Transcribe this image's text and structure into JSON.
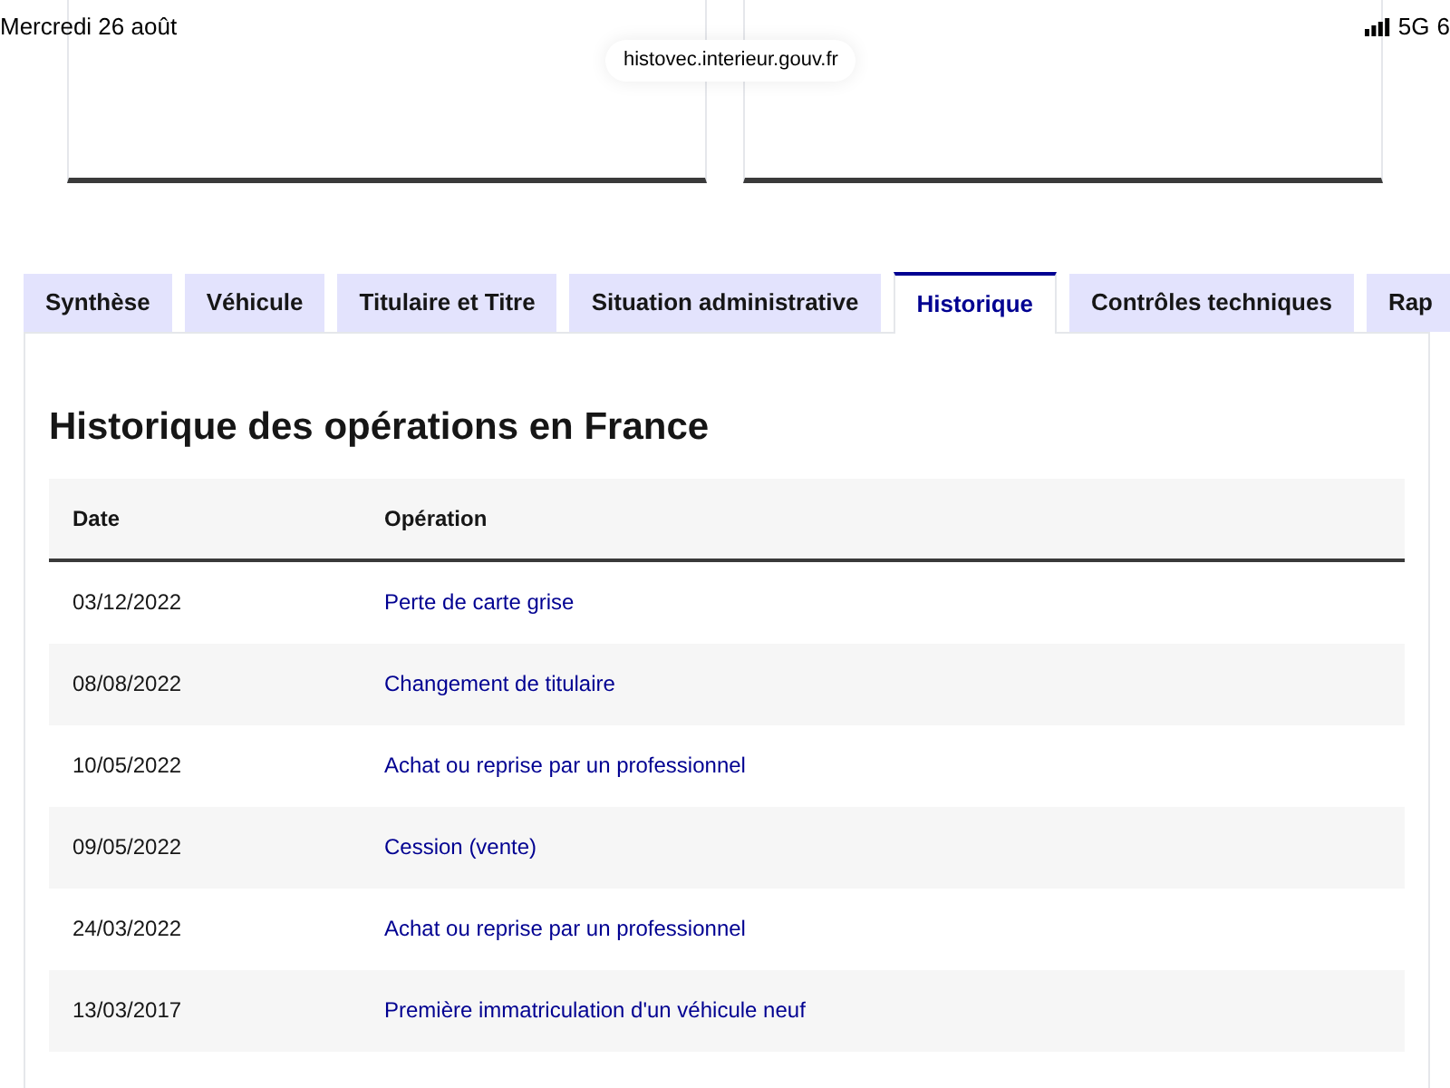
{
  "status_bar": {
    "date": "Mercredi 26 août",
    "network": "5G",
    "battery": "6"
  },
  "address_bar": {
    "url": "histovec.interieur.gouv.fr"
  },
  "tabs": [
    {
      "label": "Synthèse",
      "selected": false
    },
    {
      "label": "Véhicule",
      "selected": false
    },
    {
      "label": "Titulaire et Titre",
      "selected": false
    },
    {
      "label": "Situation administrative",
      "selected": false
    },
    {
      "label": "Historique",
      "selected": true
    },
    {
      "label": "Contrôles techniques",
      "selected": false
    },
    {
      "label": "Rap",
      "selected": false
    }
  ],
  "panel": {
    "title": "Historique des opérations en France",
    "table": {
      "columns": [
        "Date",
        "Opération"
      ],
      "rows": [
        {
          "date": "03/12/2022",
          "operation": "Perte de carte grise"
        },
        {
          "date": "08/08/2022",
          "operation": "Changement de titulaire"
        },
        {
          "date": "10/05/2022",
          "operation": "Achat ou reprise par un professionnel"
        },
        {
          "date": "09/05/2022",
          "operation": "Cession (vente)"
        },
        {
          "date": "24/03/2022",
          "operation": "Achat ou reprise par un professionnel"
        },
        {
          "date": "13/03/2017",
          "operation": "Première immatriculation d'un véhicule neuf"
        }
      ]
    }
  }
}
